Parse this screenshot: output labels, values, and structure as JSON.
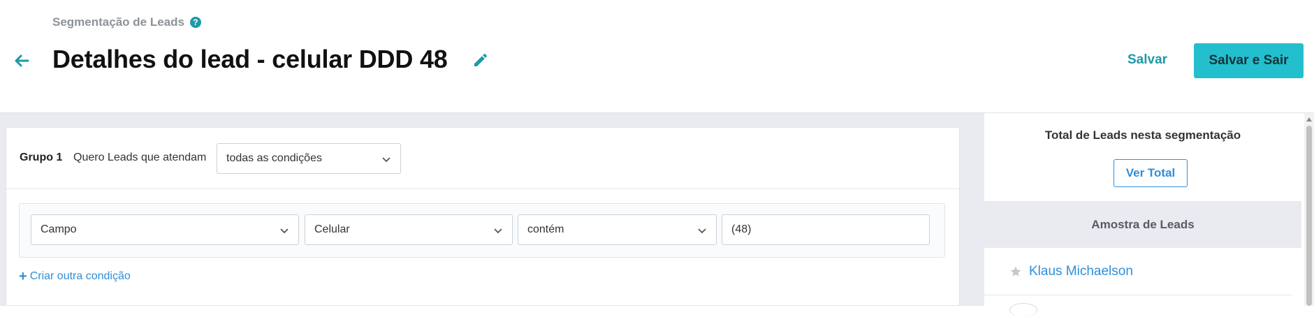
{
  "header": {
    "breadcrumb": "Segmentação de Leads",
    "title": "Detalhes do lead - celular DDD 48",
    "save_label": "Salvar",
    "save_exit_label": "Salvar e Sair",
    "icons": {
      "back": "arrow-left-icon",
      "help": "question-circle-icon",
      "edit": "pencil-icon"
    }
  },
  "group": {
    "label": "Grupo 1",
    "text": "Quero Leads que atendam",
    "match_select": "todas as condições",
    "condition": {
      "field_type": "Campo",
      "field": "Celular",
      "operator": "contém",
      "value": "(48)"
    },
    "add_condition_label": "Criar outra condição"
  },
  "sidebar": {
    "total_title": "Total de Leads nesta segmentação",
    "total_button": "Ver Total",
    "sample_title": "Amostra de Leads",
    "leads": [
      {
        "name": "Klaus Michaelson"
      }
    ]
  },
  "colors": {
    "accent": "#23bfce",
    "accent_text": "#1d9aa8",
    "link": "#2f8fd8",
    "background": "#e9ebf0"
  }
}
